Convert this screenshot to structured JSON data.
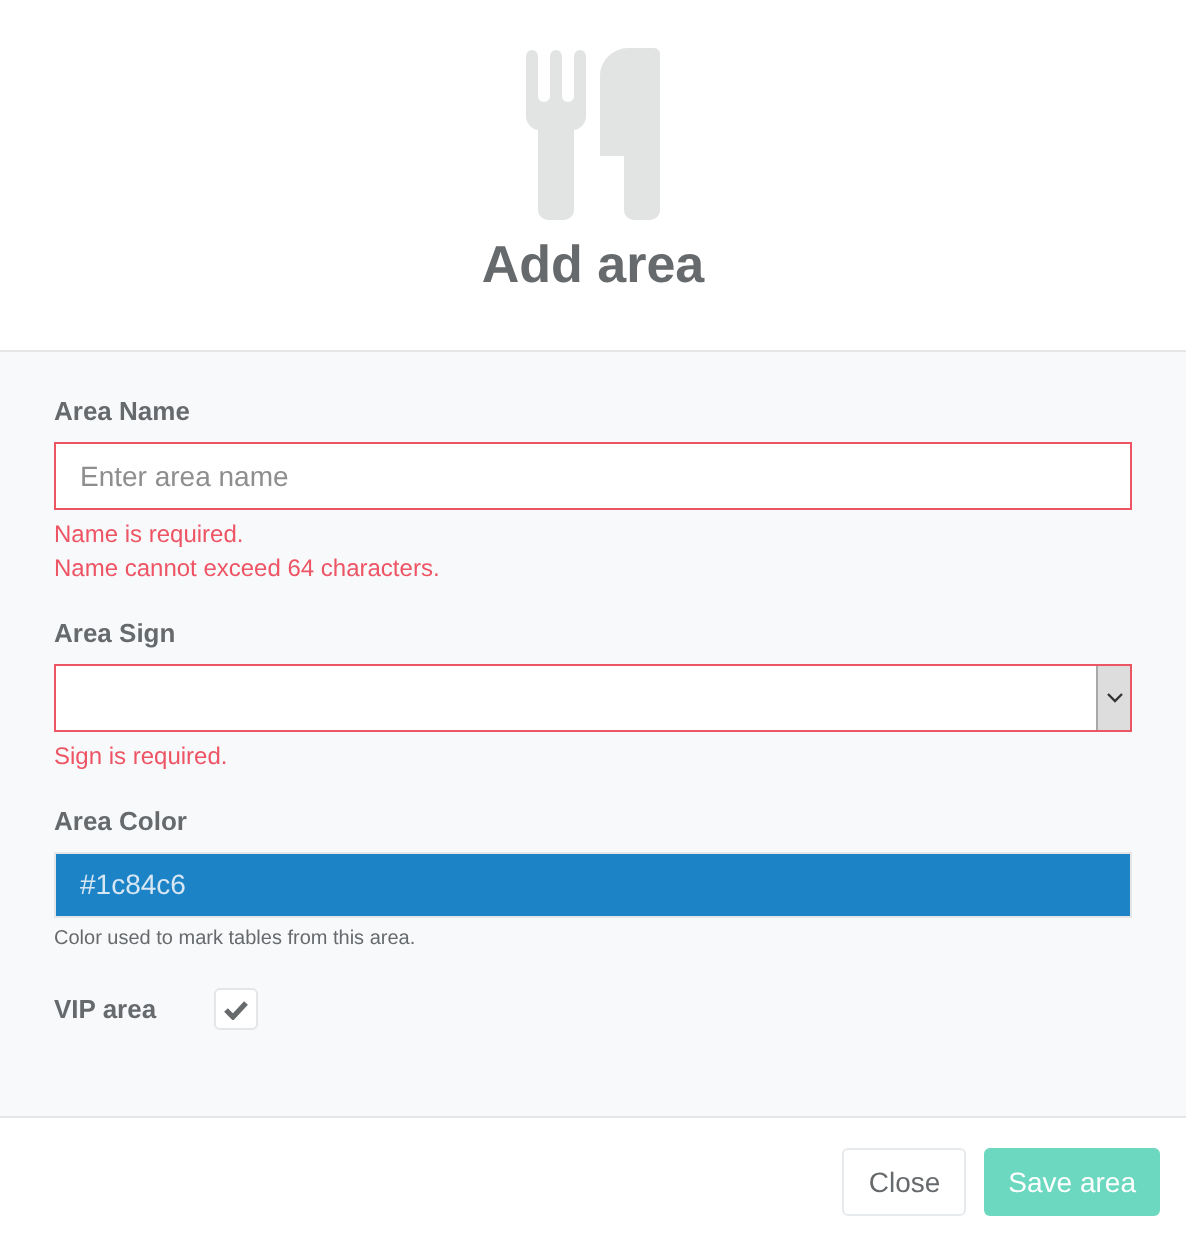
{
  "header": {
    "title": "Add area"
  },
  "fields": [
    {
      "kind": "text",
      "label": "Area Name",
      "placeholder": "Enter area name",
      "invalid": true,
      "errors": [
        "Name is required.",
        "Name cannot exceed 64 characters."
      ]
    },
    {
      "kind": "select",
      "label": "Area Sign",
      "invalid": true,
      "errors": [
        "Sign is required."
      ]
    },
    {
      "kind": "color",
      "label": "Area Color",
      "value": "#1c84c6",
      "color": "#1c84c6",
      "help": "Color used to mark tables from this area."
    },
    {
      "kind": "checkbox",
      "label": "VIP area",
      "checked": true
    }
  ],
  "buttons": [
    {
      "label": "Close",
      "kind": "secondary",
      "disabled": false
    },
    {
      "label": "Save area",
      "kind": "primary",
      "disabled": true
    }
  ]
}
